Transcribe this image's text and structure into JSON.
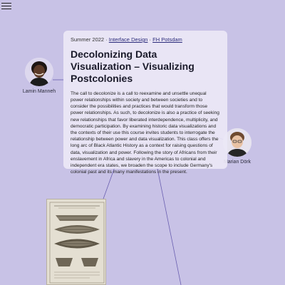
{
  "nav": {
    "menu_icon": "hamburger-menu-icon"
  },
  "people": [
    {
      "name": "Lamin Manneh"
    },
    {
      "name": "Marian Dörk"
    }
  ],
  "course": {
    "term": "Summer 2022",
    "separator": "·",
    "program": "Interface Design",
    "institution": "FH Potsdam",
    "title": "Decolonizing Data Visualization – Visualizing Postcolonies",
    "description": "The call to decolonize is a call to reexamine and unsettle unequal power relationships within society and between societies and to consider the possibilities and practices that would transform those power relationships. As such, to decolonize is also a practice of seeking new relationships that favor liberated interdependence, multiplicity, and democratic participation. By examining historic data visualizations and the contexts of their use this course invites students to interrogate the relationship between power and data visualization. This class offers the long arc of Black Atlantic History as a context for raising questions of data, visualization and power. Following the story of Africans from their enslavement in Africa and slavery in the Americas to colonial and independent era states, we broaden the scope to include Germany's colonial past and its many manifestations in the present."
  },
  "colors": {
    "background": "#c8c2e6",
    "card": "#ebe8f6",
    "connector": "#6a5fb0",
    "link": "#2a2a7a"
  }
}
